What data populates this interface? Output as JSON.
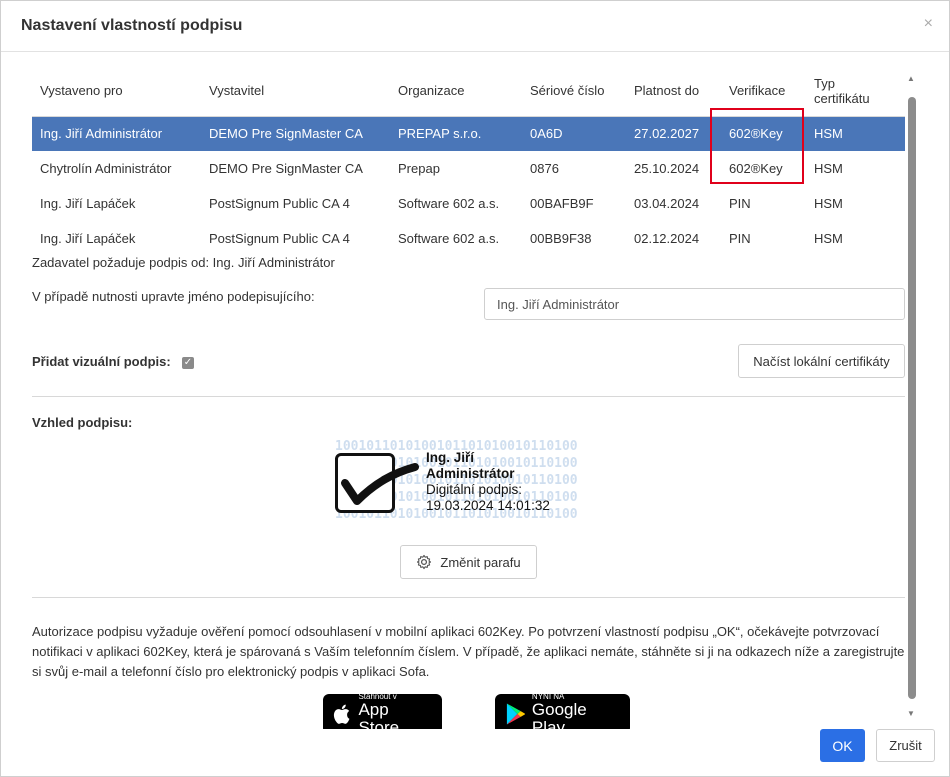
{
  "dialog": {
    "title": "Nastavení vlastností podpisu",
    "close_glyph": "×"
  },
  "table": {
    "headers": [
      "Vystaveno pro",
      "Vystavitel",
      "Organizace",
      "Sériové číslo",
      "Platnost do",
      "Verifikace",
      "Typ certifikátu"
    ],
    "header_type_line1": "Typ",
    "header_type_line2": "certifikátu",
    "rows": [
      {
        "vystaveno": "Ing. Jiří Administrátor",
        "vystavitel": "DEMO Pre SignMaster CA",
        "organizace": "PREPAP s.r.o.",
        "serial": "0A6D",
        "platnost": "27.02.2027",
        "verifikace": "602®Key",
        "typ": "HSM"
      },
      {
        "vystaveno": "Chytrolín Administrátor",
        "vystavitel": "DEMO Pre SignMaster CA",
        "organizace": "Prepap",
        "serial": "0876",
        "platnost": "25.10.2024",
        "verifikace": "602®Key",
        "typ": "HSM"
      },
      {
        "vystaveno": "Ing. Jiří Lapáček",
        "vystavitel": "PostSignum Public CA 4",
        "organizace": "Software 602 a.s.",
        "serial": "00BAFB9F",
        "platnost": "03.04.2024",
        "verifikace": "PIN",
        "typ": "HSM"
      },
      {
        "vystaveno": "Ing. Jiří Lapáček",
        "vystavitel": "PostSignum Public CA 4",
        "organizace": "Software 602 a.s.",
        "serial": "00BB9F38",
        "platnost": "02.12.2024",
        "verifikace": "PIN",
        "typ": "HSM"
      }
    ],
    "selected_row_index": 0
  },
  "requester_text": "Zadavatel požaduje podpis od: Ing. Jiří Administrátor",
  "signer_label": "V případě nutnosti upravte jméno podepisujícího:",
  "signer_value": "Ing. Jiří Administrátor",
  "visual_sig_label": "Přidat vizuální podpis:",
  "visual_sig_checked": true,
  "load_certs_button": "Načíst lokální certifikáty",
  "appearance_label": "Vzhled podpisu:",
  "signature": {
    "binary_lines": [
      "1001011010100101101010010110100",
      "1001011010100101101010010110100",
      "1001011010100101101010010110100",
      "1001011010100101101010010110100",
      "1001011010100101101010010110100"
    ],
    "name_line1": "Ing. Jiří",
    "name_line2": "Administrátor",
    "digital_label": "Digitální podpis:",
    "datetime": "19.03.2024 14:01:32"
  },
  "change_paraph_button": "Změnit parafu",
  "info_text": "Autorizace podpisu vyžaduje ověření pomocí odsouhlasení v mobilní aplikaci 602Key. Po potvrzení vlastností podpisu „OK“, očekávejte potvrzovací notifikaci v aplikaci 602Key, která je spárovaná s Vaším telefonním číslem. V případě, že aplikaci nemáte, stáhněte si ji na odkazech níže a zaregistrujte si svůj e-mail a telefonní číslo pro elektronický podpis v aplikaci Sofa.",
  "app_store": {
    "small": "Stáhnout v",
    "big": "App Store"
  },
  "google_play": {
    "small": "NYNÍ NA",
    "big": "Google Play"
  },
  "ok_button": "OK",
  "cancel_button": "Zrušit",
  "colors": {
    "selected_row": "#4a76b8",
    "primary": "#2b6fe5",
    "highlight": "#e0001b"
  },
  "icons": [
    "close-icon",
    "checkbox-icon",
    "gear-icon",
    "apple-icon",
    "google-play-icon",
    "scroll-up-icon",
    "scroll-down-icon",
    "signature-check-icon"
  ]
}
